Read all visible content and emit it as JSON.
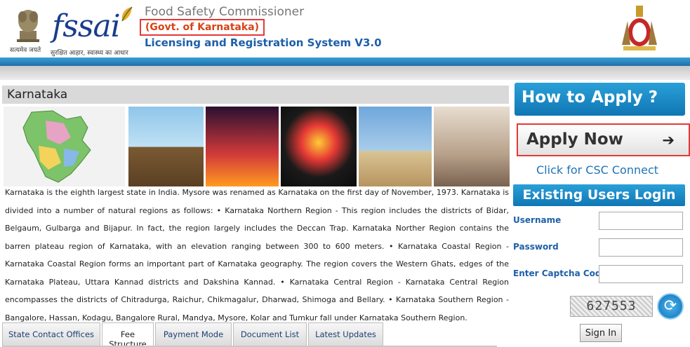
{
  "header": {
    "emblem_caption": "सत्यमेव जयते",
    "logo_text": "fssai",
    "logo_tagline": "सुरक्षित आहार, स्वास्थ्य का आधार",
    "title_line1": "Food Safety Commissioner",
    "title_line2": "(Govt. of Karnataka)",
    "title_line3": "Licensing and Registration System V3.0"
  },
  "state": {
    "title": "Karnataka",
    "description": "Karnataka is the eighth largest state in India. Mysore was renamed as Karnataka on the first day of November, 1973. Karnataka is divided into a number of natural regions as follows: • Karnataka Northern Region - This region includes the districts of Bidar, Belgaum, Gulbarga and Bijapur. In fact, the region largely includes the Deccan Trap. Karnataka Norther Region contains the barren plateau region of Karnataka, with an elevation ranging between 300 to 600 meters. • Karnataka Coastal Region - Karnataka Coastal Region forms an important part of Karnataka geography. The region covers the Western Ghats, edges of the Karnataka Plateau, Uttara Kannad districts and Dakshina Kannad. • Karnataka Central Region - Karnataka Central Region encompasses the districts of Chitradurga, Raichur, Chikmagalur, Dharwad, Shimoga and Bellary. • Karnataka Southern Region - Bangalore, Hassan, Kodagu, Bangalore Rural, Mandya, Mysore, Kolar and Tumkur fall under Karnataka Southern Region."
  },
  "tabs": [
    {
      "label": "State Contact Offices"
    },
    {
      "label": "Fee Structure"
    },
    {
      "label": "Payment Mode"
    },
    {
      "label": "Document List"
    },
    {
      "label": "Latest Updates"
    }
  ],
  "right": {
    "how_to_apply": "How to Apply ?",
    "apply_now": "Apply Now",
    "apply_arrow": "➔",
    "csc_link": "Click for CSC Connect",
    "login_title": "Existing Users Login",
    "username_label": "Username",
    "password_label": "Password",
    "captcha_label": "Enter Captcha Code",
    "captcha_text": "627553",
    "refresh_symbol": "⟳",
    "signin_label": "Sign In"
  },
  "colors": {
    "accent_blue": "#1e73b8",
    "highlight_red": "#e53935"
  }
}
